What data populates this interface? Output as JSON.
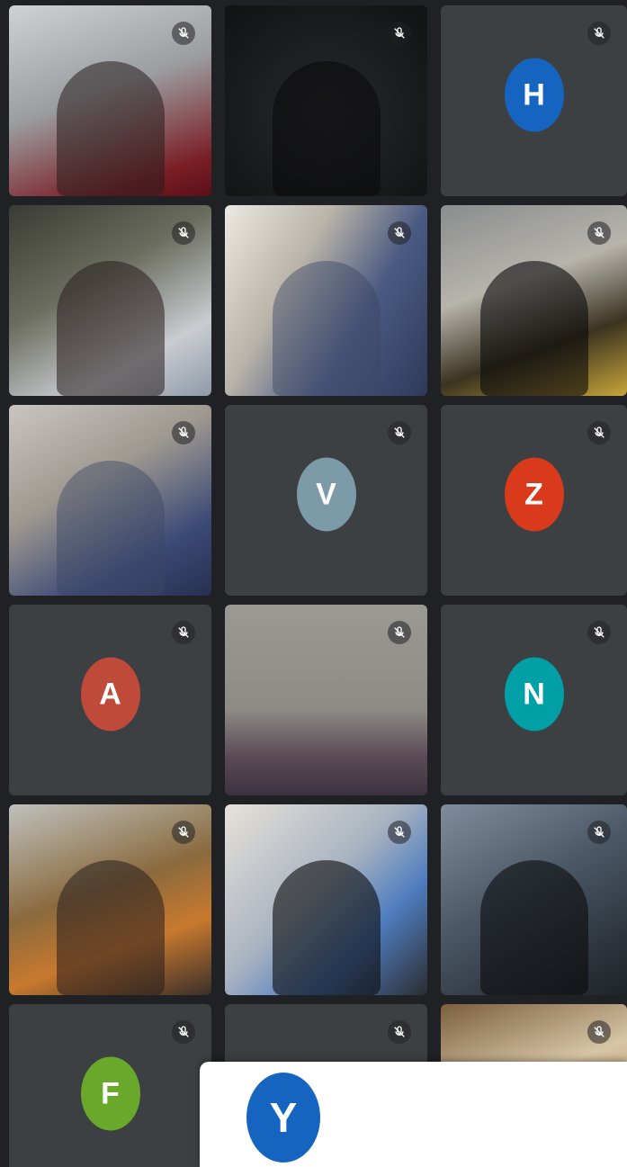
{
  "participants": [
    {
      "name": "",
      "mic": "mic-off-icon"
    },
    {
      "name": "",
      "mic": "mic-off-icon"
    },
    {
      "name": "",
      "initial": "H",
      "color": "#1565c0",
      "mic": "mic-off-icon"
    },
    {
      "name": "",
      "mic": "mic-off-icon"
    },
    {
      "name": "",
      "mic": "mic-off-icon"
    },
    {
      "name": "",
      "mic": "mic-off-icon"
    },
    {
      "name": "",
      "mic": "mic-off-icon"
    },
    {
      "name": "",
      "initial": "V",
      "color": "#7d9aa8",
      "mic": "mic-off-icon"
    },
    {
      "name": "",
      "initial": "Z",
      "color": "#d93a1b",
      "mic": "mic-off-icon"
    },
    {
      "name": "",
      "initial": "A",
      "color": "#bf4a3a",
      "mic": "mic-off-icon"
    },
    {
      "name": "",
      "mic": "mic-off-icon"
    },
    {
      "name": "",
      "initial": "N",
      "color": "#00a0a6",
      "mic": "mic-off-icon"
    },
    {
      "name": "",
      "mic": "mic-off-icon"
    },
    {
      "name": "",
      "mic": "mic-off-icon"
    },
    {
      "name": "",
      "mic": "mic-off-icon"
    },
    {
      "name": "",
      "initial": "F",
      "color": "#6aa82c",
      "mic": "mic-off-icon"
    },
    {
      "name": "",
      "mic": "mic-off-icon"
    },
    {
      "name": "",
      "mic": "mic-off-icon"
    }
  ],
  "toast": {
    "initial": "Y",
    "color": "#1565c0",
    "line1": "",
    "line2": ""
  }
}
